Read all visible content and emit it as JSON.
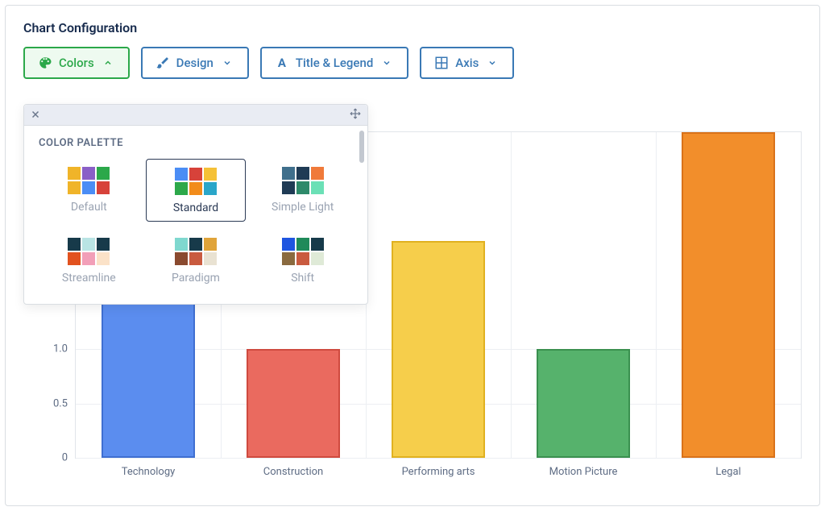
{
  "panel": {
    "title": "Chart Configuration"
  },
  "toolbar": {
    "colors_label": "Colors",
    "design_label": "Design",
    "title_legend_label": "Title & Legend",
    "axis_label": "Axis"
  },
  "popup": {
    "section_label": "COLOR PALETTE",
    "selected": "Standard",
    "palettes": [
      {
        "name": "Default",
        "colors": [
          "#f0b429",
          "#8a5fc7",
          "#2ca84a",
          "#f0b429",
          "#4b8df5",
          "#d7423a"
        ]
      },
      {
        "name": "Standard",
        "colors": [
          "#4b8df5",
          "#d7423a",
          "#f5c137",
          "#2ca84a",
          "#f28c1b",
          "#2aa6c9"
        ]
      },
      {
        "name": "Simple Light",
        "colors": [
          "#3f6f8c",
          "#1f3b55",
          "#f07a3a",
          "#1f3b55",
          "#2e8a6a",
          "#6be0b6"
        ]
      },
      {
        "name": "Streamline",
        "colors": [
          "#173a4a",
          "#b9e4e4",
          "#173a4a",
          "#e2521f",
          "#f29fb8",
          "#fbe2c8"
        ]
      },
      {
        "name": "Paradigm",
        "colors": [
          "#7fd8cf",
          "#173a4a",
          "#e0a43a",
          "#8a4a2f",
          "#c95b3f",
          "#e9e2d2"
        ]
      },
      {
        "name": "Shift",
        "colors": [
          "#1f55e0",
          "#1f8a5a",
          "#173a4a",
          "#8a6a3f",
          "#c95b3f",
          "#dfead7"
        ]
      }
    ]
  },
  "colors": {
    "bar_fill": [
      "#5b8def",
      "#ea6a5f",
      "#f6ce4b",
      "#56b26c",
      "#f28e2b"
    ],
    "bar_stroke": [
      "#3f6fd1",
      "#cf4a3f",
      "#e0b120",
      "#3a904f",
      "#d9721a"
    ]
  },
  "chart_data": {
    "type": "bar",
    "categories": [
      "Technology",
      "Construction",
      "Performing arts",
      "Motion Picture",
      "Legal"
    ],
    "values": [
      1.7,
      1.0,
      2.0,
      1.0,
      3.0
    ],
    "title": "",
    "xlabel": "",
    "ylabel": "",
    "ylim": [
      0,
      3
    ],
    "yticks": [
      0,
      0.5,
      1.0
    ]
  }
}
